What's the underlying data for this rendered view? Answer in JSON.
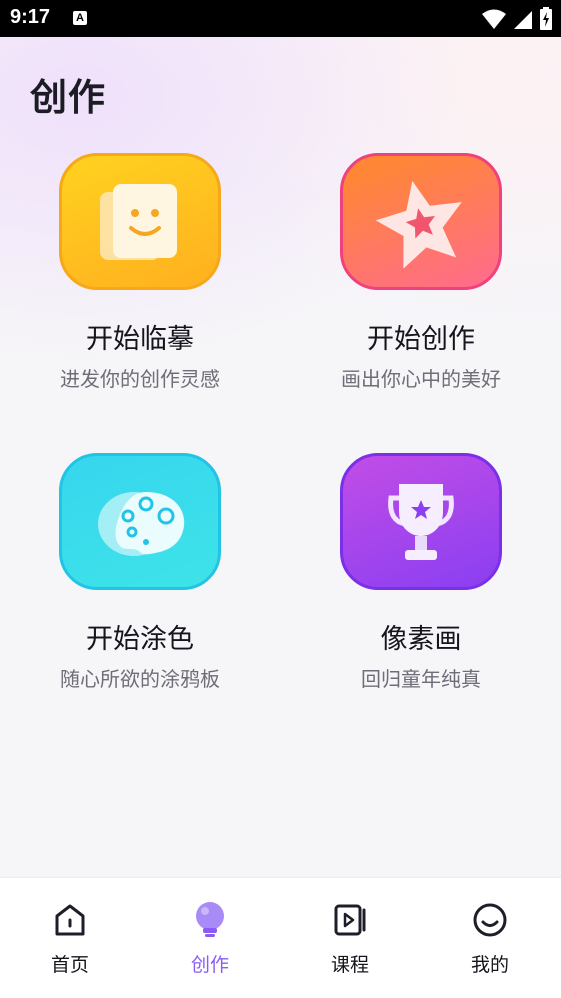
{
  "status_bar": {
    "time": "9:17",
    "notification_letter": "A"
  },
  "page": {
    "title": "创作"
  },
  "cards": [
    {
      "title": "开始临摹",
      "subtitle": "进发你的创作灵感",
      "icon": "smiley-card-icon",
      "color": "#ffc21f"
    },
    {
      "title": "开始创作",
      "subtitle": "画出你心中的美好",
      "icon": "star-icon",
      "color": "#ff7a5a"
    },
    {
      "title": "开始涂色",
      "subtitle": "随心所欲的涂鸦板",
      "icon": "palette-icon",
      "color": "#3adcea"
    },
    {
      "title": "像素画",
      "subtitle": "回归童年纯真",
      "icon": "trophy-icon",
      "color": "#a445ec"
    }
  ],
  "nav": {
    "active_color": "#8a5cf5",
    "items": [
      {
        "label": "首页",
        "icon": "home-icon",
        "active": false
      },
      {
        "label": "创作",
        "icon": "bulb-icon",
        "active": true
      },
      {
        "label": "课程",
        "icon": "video-icon",
        "active": false
      },
      {
        "label": "我的",
        "icon": "smile-face-icon",
        "active": false
      }
    ]
  }
}
